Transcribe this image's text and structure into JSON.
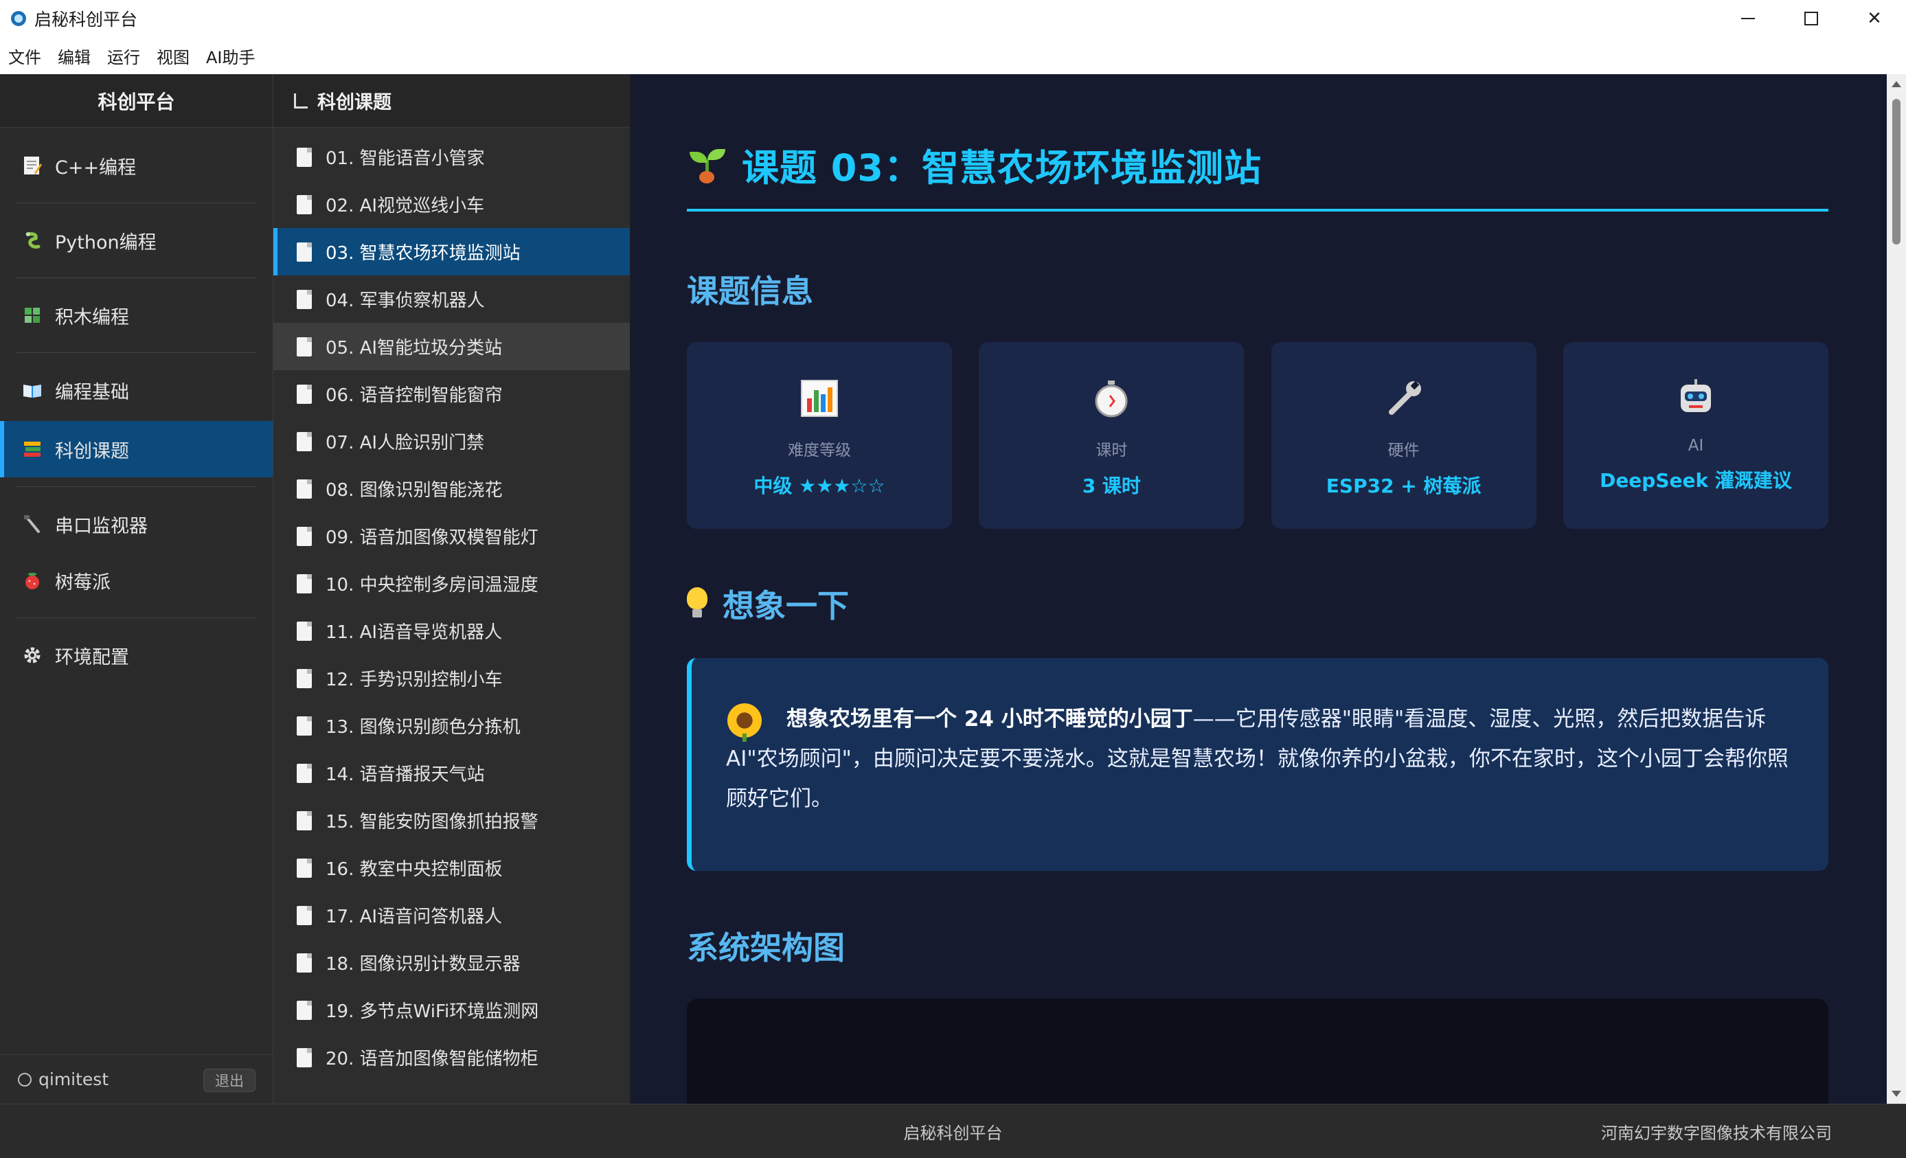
{
  "window": {
    "title": "启秘科创平台",
    "controls": {
      "minimize": "minimize",
      "maximize": "maximize",
      "close": "✕"
    }
  },
  "menubar": [
    "文件",
    "编辑",
    "运行",
    "视图",
    "AI助手"
  ],
  "sidebar": {
    "header": "科创平台",
    "items": [
      {
        "label": "C++编程",
        "icon": "memo-icon"
      },
      {
        "label": "Python编程",
        "icon": "snake-icon"
      },
      {
        "label": "积木编程",
        "icon": "puzzle-icon"
      },
      {
        "label": "编程基础",
        "icon": "book-icon"
      },
      {
        "label": "科创课题",
        "icon": "books-stack-icon",
        "active": true
      },
      {
        "label": "串口监视器",
        "icon": "cable-icon"
      },
      {
        "label": "树莓派",
        "icon": "raspberry-icon"
      },
      {
        "label": "环境配置",
        "icon": "gear-icon"
      }
    ],
    "user": "qimitest",
    "logout": "退出"
  },
  "topics": {
    "header": "科创课题",
    "items": [
      "01. 智能语音小管家",
      "02. AI视觉巡线小车",
      "03. 智慧农场环境监测站",
      "04. 军事侦察机器人",
      "05. AI智能垃圾分类站",
      "06. 语音控制智能窗帘",
      "07. AI人脸识别门禁",
      "08. 图像识别智能浇花",
      "09. 语音加图像双模智能灯",
      "10. 中央控制多房间温湿度",
      "11. AI语音导览机器人",
      "12. 手势识别控制小车",
      "13. 图像识别颜色分拣机",
      "14. 语音播报天气站",
      "15. 智能安防图像抓拍报警",
      "16. 教室中央控制面板",
      "17. AI语音问答机器人",
      "18. 图像识别计数显示器",
      "19. 多节点WiFi环境监测网",
      "20. 语音加图像智能储物柜"
    ],
    "active_index": 2,
    "hover_index": 4
  },
  "main": {
    "title": "课题 03：智慧农场环境监测站",
    "info_section": "课题信息",
    "cards": [
      {
        "label": "难度等级",
        "value": "中级 ★★★☆☆",
        "icon": "bar-chart-icon"
      },
      {
        "label": "课时",
        "value": "3 课时",
        "icon": "stopwatch-icon"
      },
      {
        "label": "硬件",
        "value": "ESP32 + 树莓派",
        "icon": "wrench-icon"
      },
      {
        "label": "AI",
        "value": "DeepSeek 灌溉建议",
        "icon": "robot-icon"
      }
    ],
    "imagine_section": "想象一下",
    "callout": {
      "bold": "想象农场里有一个 24 小时不睡觉的小园丁",
      "text": "——它用传感器\"眼睛\"看温度、湿度、光照，然后把数据告诉 AI\"农场顾问\"，由顾问决定要不要浇水。这就是智慧农场！就像你养的小盆栽，你不在家时，这个小园丁会帮你照顾好它们。"
    },
    "arch_section": "系统架构图"
  },
  "statusbar": {
    "center": "启秘科创平台",
    "right": "河南幻宇数字图像技术有限公司"
  },
  "colors": {
    "accent": "#1ec8ff",
    "active_bg": "#0c4a7c",
    "main_bg": "#161a2e",
    "card_bg": "#1b2748"
  }
}
